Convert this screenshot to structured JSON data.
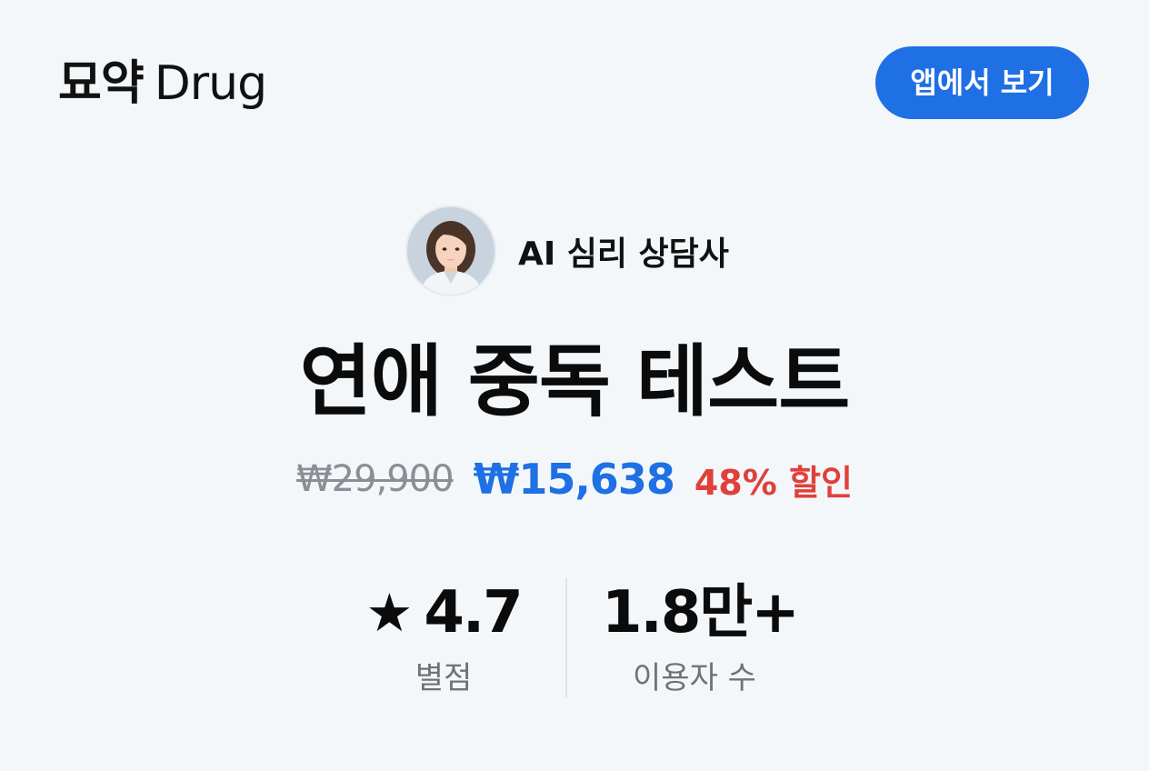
{
  "header": {
    "logo_ko": "묘약",
    "logo_en": "Drug",
    "app_button_label": "앱에서 보기"
  },
  "counselor": {
    "label": "AI 심리 상담사",
    "avatar_icon": "counselor-avatar"
  },
  "product": {
    "title": "연애 중독 테스트"
  },
  "price": {
    "original": "₩29,900",
    "sale": "₩15,638",
    "discount": "48% 할인"
  },
  "stats": {
    "rating": {
      "icon": "star-icon",
      "value": "4.7",
      "label": "별점"
    },
    "users": {
      "value": "1.8만+",
      "label": "이용자 수"
    }
  },
  "colors": {
    "background": "#f3f7f9",
    "accent": "#1f6fe5",
    "discount": "#e0403c",
    "muted": "#8a8f96"
  }
}
